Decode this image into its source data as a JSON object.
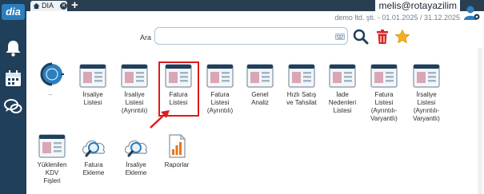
{
  "app": {
    "logo_text": "dia"
  },
  "tabs": [
    {
      "label": "DIA"
    }
  ],
  "header": {
    "user": "melis@rotayazilim",
    "company_period": "demo ltd. şti. - 01.01.2025 / 31.12.2025"
  },
  "search": {
    "label": "Ara",
    "value": "",
    "placeholder": ""
  },
  "tiles": [
    {
      "id": "up",
      "label": "..",
      "icon": "back-circle-icon"
    },
    {
      "id": "irsaliye-listesi",
      "label": "İrsaliye\nListesi",
      "icon": "window-list-icon"
    },
    {
      "id": "irsaliye-listesi-ayrintili",
      "label": "İrsaliye\nListesi\n(Ayrıntılı)",
      "icon": "window-list-icon"
    },
    {
      "id": "fatura-listesi",
      "label": "Fatura\nListesi",
      "icon": "window-list-icon"
    },
    {
      "id": "fatura-listesi-ayrintili",
      "label": "Fatura\nListesi\n(Ayrıntılı)",
      "icon": "window-list-icon"
    },
    {
      "id": "genel-analiz",
      "label": "Genel\nAnaliz",
      "icon": "window-list-icon"
    },
    {
      "id": "hizli-satis",
      "label": "Hızlı Satış\nve Tahsilat",
      "icon": "window-list-icon"
    },
    {
      "id": "iade-nedenleri",
      "label": "İade\nNedenleri\nListesi",
      "icon": "window-list-icon"
    },
    {
      "id": "fatura-listesi-varyantli",
      "label": "Fatura\nListesi\n(Ayrıntılı-\nVaryantlı)",
      "icon": "window-list-icon"
    },
    {
      "id": "irsaliye-listesi-varyantli",
      "label": "İrsaliye\nListesi\n(Ayrıntılı-\nVaryantlı)",
      "icon": "window-list-icon"
    },
    {
      "id": "yuklenilen-kdv",
      "label": "Yüklenilen\nKDV\nFişleri",
      "icon": "window-list-icon"
    },
    {
      "id": "fatura-ekleme",
      "label": "Fatura\nEkleme",
      "icon": "cloud-search-icon"
    },
    {
      "id": "irsaliye-ekleme",
      "label": "İrsaliye\nEkleme",
      "icon": "cloud-search-icon"
    },
    {
      "id": "raporlar",
      "label": "Raporlar",
      "icon": "report-chart-icon"
    }
  ],
  "colors": {
    "sidebar": "#1f3f5b",
    "topbar": "#2a3e52",
    "accent": "#2c7fbd",
    "highlight": "#e01b1b"
  }
}
